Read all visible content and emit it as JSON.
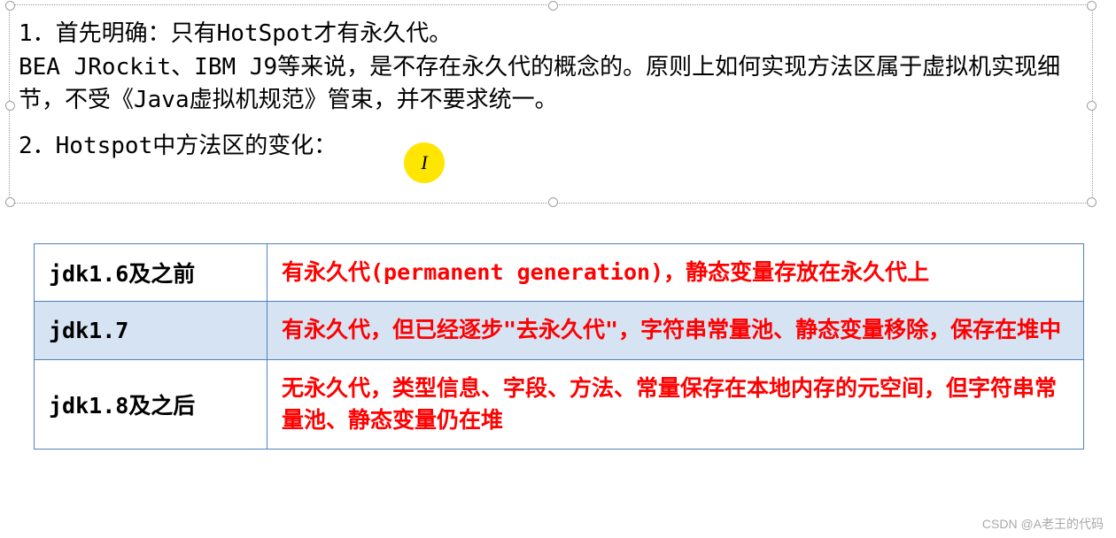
{
  "textbox": {
    "line1": "1．首先明确：只有HotSpot才有永久代。",
    "line2": "BEA JRockit、IBM J9等来说，是不存在永久代的概念的。原则上如何实现方法区属于虚拟机实现细节，不受《Java虚拟机规范》管束，并不要求统一。",
    "line3": "2．Hotspot中方法区的变化："
  },
  "cursor_glyph": "I",
  "table": {
    "rows": [
      {
        "left": "jdk1.6及之前",
        "right": "有永久代(permanent generation)，静态变量存放在永久代上"
      },
      {
        "left": "jdk1.7",
        "right": "有永久代，但已经逐步\"去永久代\"，字符串常量池、静态变量移除，保存在堆中"
      },
      {
        "left": "jdk1.8及之后",
        "right": "无永久代，类型信息、字段、方法、常量保存在本地内存的元空间，但字符串常量池、静态变量仍在堆"
      }
    ]
  },
  "watermark": "CSDN @A老王的代码"
}
